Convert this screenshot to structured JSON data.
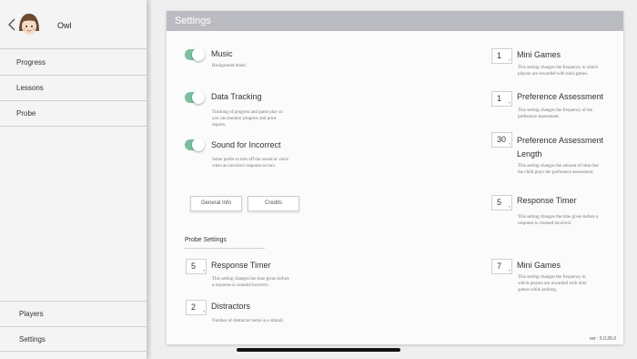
{
  "profile": {
    "name": "Owl"
  },
  "nav": {
    "top": [
      "Progress",
      "Lessons",
      "Probe"
    ],
    "bottom": [
      "Players",
      "Settings"
    ]
  },
  "header": {
    "title": "Settings"
  },
  "toggles": [
    {
      "title": "Music",
      "desc": [
        "Background music"
      ],
      "on": true
    },
    {
      "title": "Data Tracking",
      "desc": [
        "Tracking of progress and game play so",
        "you can monitor progress and print",
        "reports."
      ],
      "on": true
    },
    {
      "title": "Sound for Incorrect",
      "desc": [
        "Some prefer to turn off the sound or voice",
        "when an incorrect response occurs."
      ],
      "on": true
    }
  ],
  "right_settings": [
    {
      "value": "1",
      "title": [
        "Mini Games"
      ],
      "desc": [
        "This setting changes the frequency in which",
        "players are rewarded with mini games."
      ]
    },
    {
      "value": "1",
      "title": [
        "Preference Assessment"
      ],
      "desc": [
        "This setting changes the frequency of the",
        "preference assessment."
      ]
    },
    {
      "value": "30",
      "title": [
        "Preference Assessment",
        "Length"
      ],
      "desc": [
        "This setting changes the amount of time that",
        "the child plays the preference assessment."
      ]
    },
    {
      "value": "5",
      "title": [
        "Response Timer"
      ],
      "desc": [
        "This setting changes the time given before a",
        "response is counted incorrect."
      ]
    },
    {
      "value": "7",
      "title": [
        "Mini Games"
      ],
      "desc": [
        "This setting changes the frequency in",
        "which players are rewarded with mini",
        "games while probing."
      ]
    }
  ],
  "buttons": {
    "general_info": "General Info",
    "credits": "Credits"
  },
  "probe": {
    "section_title": "Probe Settings",
    "items": [
      {
        "value": "5",
        "title": "Response Timer",
        "desc": [
          "This setting changes the time given before",
          "a response is counted incorrect."
        ]
      },
      {
        "value": "2",
        "title": "Distractors",
        "desc": [
          "Number of distractor items in a stimuli."
        ]
      }
    ]
  },
  "version": "ver : 5.0.26.0",
  "colors": {
    "toggle_on": "#7bbfa0",
    "header_bg": "#bbbcc2"
  }
}
